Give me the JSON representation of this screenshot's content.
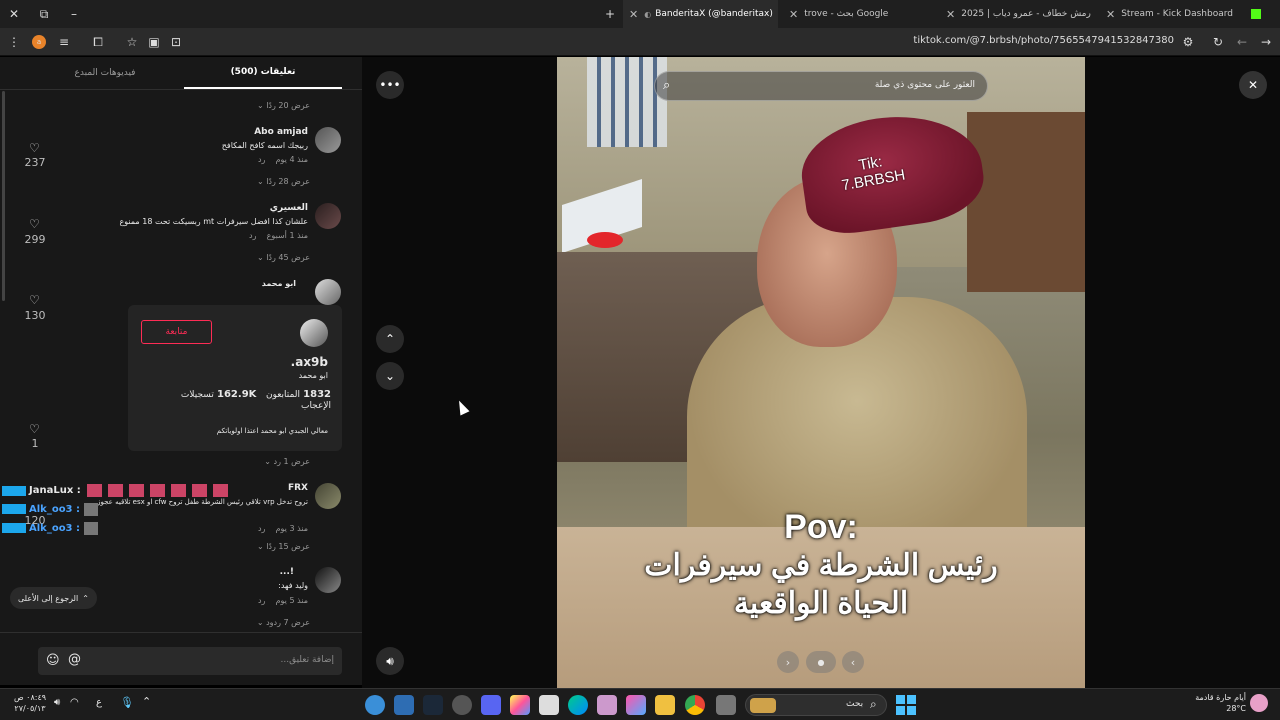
{
  "tabs": [
    {
      "label": "Stream - Kick Dashboard"
    },
    {
      "label": "رمش خطاف - عمرو دياب | 2025"
    },
    {
      "label": "trove - بحث Google"
    },
    {
      "label": "BanderitaX (@banderitax)"
    }
  ],
  "address": {
    "url": "tiktok.com/@7.brbsh/photo/7565547941532847380"
  },
  "panel": {
    "tab_comments": "(500) تعليقات",
    "tab_creator": "فيديوهات المبدع",
    "comments": [
      {
        "reply_toggle": "عرض 20 ردًا"
      },
      {
        "author": "Abo amjad",
        "text": "ربيجك اسمه كافح المكافح",
        "meta": "منذ 4 يوم",
        "reply": "رد",
        "likes": "237",
        "reply_toggle": "عرض 28 ردًا"
      },
      {
        "author": "العسيري",
        "text": "علشان كذا افضل سيرفرات mt ربسيكت تحت 18 ممنوع",
        "meta": "منذ 1 أسبوع",
        "reply": "رد",
        "likes": "299",
        "reply_toggle": "عرض 45 ردًا"
      },
      {
        "author": "ابو محمد",
        "likes": "130"
      }
    ],
    "profile_card": {
      "follow": "متابعة",
      "handle": "ax9b.",
      "name": "ابو محمد",
      "followers_value": "1832",
      "followers_label": "المتابعون",
      "likes_value": "162.9K",
      "likes_label": "تسجيلات الإعجاب",
      "bio": "معالي الجبدي ابو محمد اعتذا اولوياتكم",
      "likes_count": "1",
      "reply_toggle": "عرض 1 رد"
    },
    "frx": {
      "author": "FRX",
      "text": "تروح تدخل vrp تلاقي رئيس الشرطة طفل تروح cfw او esx تلاقيه عجوز",
      "meta": "منذ 3 يوم",
      "reply": "رد",
      "likes": "120",
      "reply_toggle": "عرض 15 ردًا"
    },
    "last": {
      "author": "!...",
      "text": "وليد فهد:",
      "meta": "منذ 5 يوم",
      "reply": "رد",
      "reply_toggle": "عرض 7 ردود"
    },
    "overlay_chat": [
      {
        "user": "JanaLux :"
      },
      {
        "user": "Alk_oo3 :"
      },
      {
        "user": "Alk_oo3 :"
      }
    ],
    "back_to_top": "الرجوع إلى الأعلى",
    "input_placeholder": "إضافة تعليق..."
  },
  "video": {
    "search_placeholder": "العثور على محتوى ذي صلة",
    "watermark_line1": "Tik:",
    "watermark_line2": "7.BRBSH",
    "caption_line1": "Pov:",
    "caption_line2": "رئيس الشرطة في سيرفرات",
    "caption_line3": "الحياة الواقعية"
  },
  "taskbar": {
    "search_label": "بحث",
    "weather_label": "أيام حارة قادمة",
    "weather_temp": "28°C",
    "time": "٠٨:٤٩ ص",
    "date": "٢٧/٠٥/١٣",
    "lang": "ع"
  },
  "colors": {
    "accent": "#fe2c55",
    "tiktok_bg": "#181818"
  }
}
